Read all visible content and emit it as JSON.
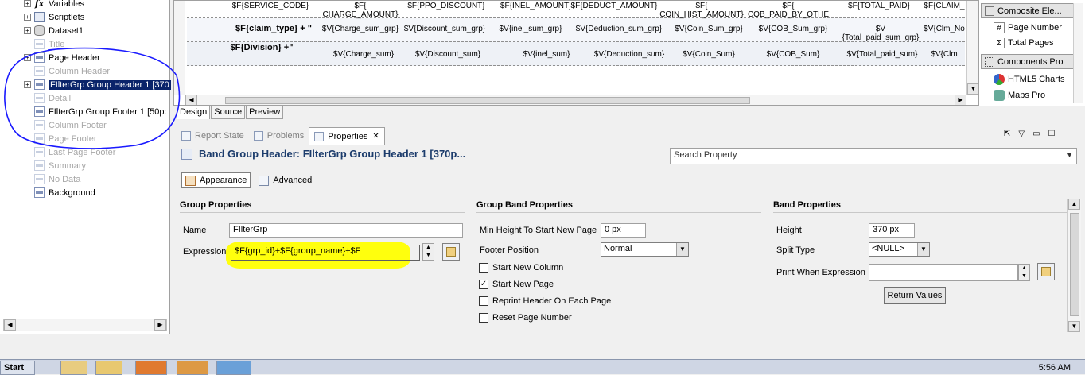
{
  "outline": {
    "items": [
      {
        "label": "Variables",
        "icon": "fx-icon",
        "expander": "+",
        "dim": false
      },
      {
        "label": "Scriptlets",
        "icon": "scriptlet-icon",
        "expander": "+",
        "dim": false
      },
      {
        "label": "Dataset1",
        "icon": "dataset-icon",
        "expander": "+",
        "dim": false
      },
      {
        "label": "Title",
        "icon": "band-icon",
        "expander": "",
        "dim": true
      },
      {
        "label": "Page Header",
        "icon": "band-icon",
        "expander": "+",
        "dim": false
      },
      {
        "label": "Column Header",
        "icon": "band-icon",
        "expander": "",
        "dim": true
      },
      {
        "label": "FIlterGrp Group Header 1 [370",
        "icon": "band-icon",
        "expander": "+",
        "dim": false,
        "selected": true
      },
      {
        "label": "Detail",
        "icon": "band-icon",
        "expander": "",
        "dim": true
      },
      {
        "label": "FIlterGrp Group Footer 1 [50p:",
        "icon": "band-icon",
        "expander": "",
        "dim": false
      },
      {
        "label": "Column Footer",
        "icon": "band-icon",
        "expander": "",
        "dim": true
      },
      {
        "label": "Page Footer",
        "icon": "band-icon",
        "expander": "",
        "dim": true
      },
      {
        "label": "Last Page Footer",
        "icon": "band-icon",
        "expander": "",
        "dim": true
      },
      {
        "label": "Summary",
        "icon": "band-icon",
        "expander": "",
        "dim": true
      },
      {
        "label": "No Data",
        "icon": "band-icon",
        "expander": "",
        "dim": true
      },
      {
        "label": "Background",
        "icon": "band-icon",
        "expander": "",
        "dim": false
      }
    ]
  },
  "designer": {
    "row1": [
      "$F{SERVICE_CODE}",
      "$F{\nCHARGE_AMOUNT}",
      "$F{PPO_DISCOUNT}",
      "$F{INEL_AMOUNT}",
      "$F{DEDUCT_AMOUNT}",
      "$F{\nCOIN_HIST_AMOUNT}",
      "$F{\nCOB_PAID_BY_OTHE",
      "$F{TOTAL_PAID}",
      "$F{CLAIM_"
    ],
    "row2_label": "$F{claim_type} + \"",
    "row2": [
      "$V{Charge_sum_grp}",
      "$V{Discount_sum_grp}",
      "$V{inel_sum_grp}",
      "$V{Deduction_sum_grp}",
      "$V{Coin_Sum_grp}",
      "$V{COB_Sum_grp}",
      "$V\n{Total_paid_sum_grp}",
      "$V{Clm_No"
    ],
    "row3_label": "$F{Division} +\"",
    "row3": [
      "$V{Charge_sum}",
      "$V{Discount_sum}",
      "$V{inel_sum}",
      "$V{Deduction_sum}",
      "$V{Coin_Sum}",
      "$V{COB_Sum}",
      "$V{Total_paid_sum}",
      "$V{Clm"
    ],
    "tabs": [
      "Design",
      "Source",
      "Preview"
    ]
  },
  "palette": {
    "cat1": "Composite Ele...",
    "item1": "Page Number",
    "item2": "Total Pages",
    "cat2": "Components Pro",
    "item3": "HTML5 Charts",
    "item4": "Maps Pro"
  },
  "panel": {
    "tabs": [
      "Report State",
      "Problems",
      "Properties"
    ],
    "title": "Band Group Header: FIlterGrp Group Header 1 [370p...",
    "search_placeholder": "Search Property",
    "subtabs": [
      "Appearance",
      "Advanced"
    ]
  },
  "group_props": {
    "heading": "Group Properties",
    "name_label": "Name",
    "name_value": "FIlterGrp",
    "expr_label": "Expression",
    "expr_value": "$F{grp_id}+$F{group_name}+$F"
  },
  "group_band": {
    "heading": "Group Band Properties",
    "min_height_label": "Min Height To Start New Page",
    "min_height_value": "0 px",
    "footer_pos_label": "Footer Position",
    "footer_pos_value": "Normal",
    "checks": [
      {
        "label": "Start New Column",
        "checked": false
      },
      {
        "label": "Start New Page",
        "checked": true
      },
      {
        "label": "Reprint Header On Each Page",
        "checked": false
      },
      {
        "label": "Reset Page Number",
        "checked": false
      }
    ]
  },
  "band_props": {
    "heading": "Band Properties",
    "height_label": "Height",
    "height_value": "370 px",
    "split_label": "Split Type",
    "split_value": "<NULL>",
    "print_when_label": "Print When Expression",
    "return_values": "Return Values"
  },
  "taskbar": {
    "start_label": "Start",
    "clock": "5:56 AM"
  },
  "colors": {
    "highlight": "#ffff00",
    "selection": "#0a246a",
    "annotation": "#1a1aff"
  }
}
